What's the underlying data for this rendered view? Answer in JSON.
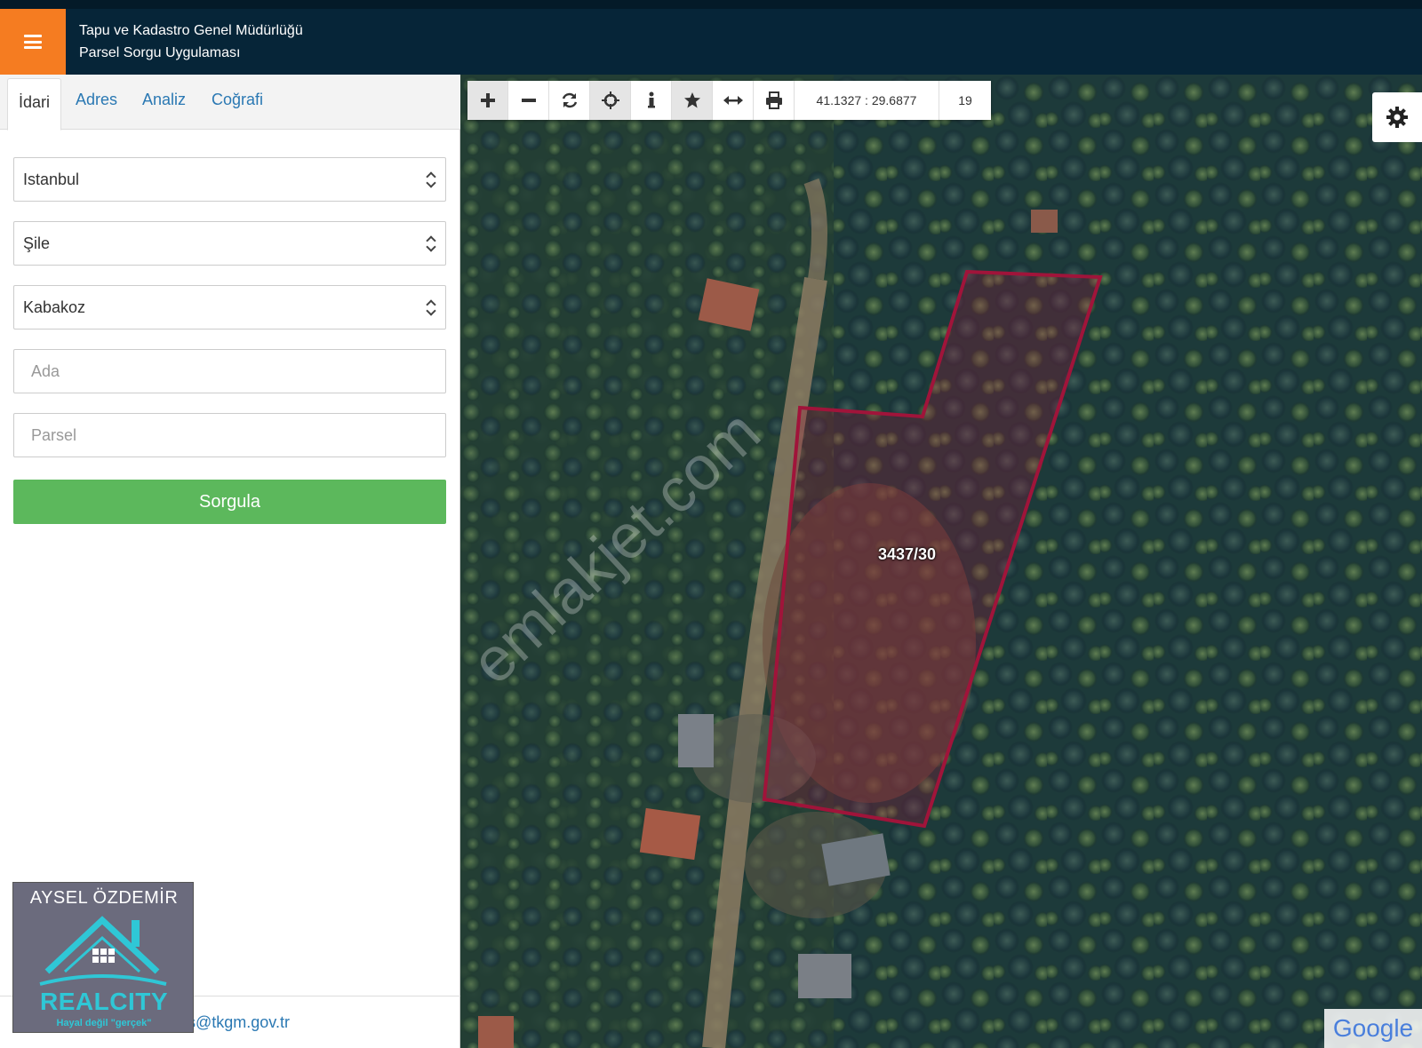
{
  "header": {
    "title_line1": "Tapu ve Kadastro Genel Müdürlüğü",
    "title_line2": "Parsel Sorgu Uygulaması"
  },
  "tabs": [
    {
      "label": "İdari",
      "active": true
    },
    {
      "label": "Adres",
      "active": false
    },
    {
      "label": "Analiz",
      "active": false
    },
    {
      "label": "Coğrafi",
      "active": false
    }
  ],
  "form": {
    "province": "Istanbul",
    "district": "Şile",
    "neighborhood": "Kabakoz",
    "ada_placeholder": "Ada",
    "parsel_placeholder": "Parsel",
    "submit_label": "Sorgula"
  },
  "footer": {
    "email": "cbs@tkgm.gov.tr"
  },
  "logo": {
    "name": "AYSEL ÖZDEMİR",
    "brand": "REALCITY",
    "tagline": "Hayal değil \"gerçek\""
  },
  "map": {
    "coordinates": "41.1327 : 29.6877",
    "zoom_level": "19",
    "parcel_label": "3437/30",
    "attribution": "Google",
    "watermark": "emlakjet.com",
    "tools": [
      "plus-icon",
      "minus-icon",
      "refresh-icon",
      "crosshair-icon",
      "info-icon",
      "star-icon",
      "measure-icon",
      "print-icon"
    ],
    "parcel_color": "#a0143a"
  }
}
